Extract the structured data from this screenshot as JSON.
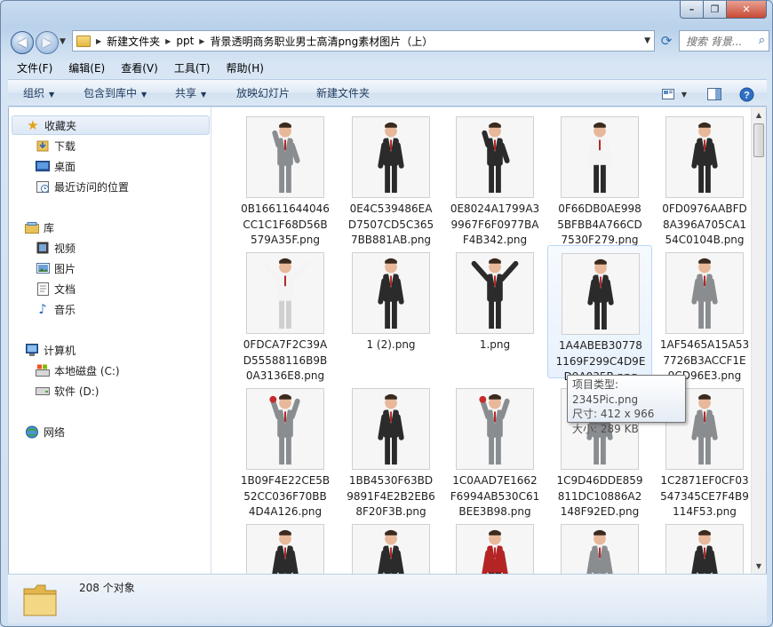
{
  "window": {
    "controls": {
      "min": "–",
      "max": "❐",
      "close": "✕"
    }
  },
  "nav": {
    "back_icon": "back-arrow-icon",
    "forward_icon": "forward-arrow-icon",
    "breadcrumbs": [
      "新建文件夹",
      "ppt",
      "背景透明商务职业男士高清png素材图片（上）"
    ],
    "search_placeholder": "搜索 背景..."
  },
  "menu": [
    "文件(F)",
    "编辑(E)",
    "查看(V)",
    "工具(T)",
    "帮助(H)"
  ],
  "toolbar": {
    "organize": "组织",
    "include_library": "包含到库中",
    "share": "共享",
    "slideshow": "放映幻灯片",
    "new_folder": "新建文件夹"
  },
  "navpane": {
    "favorites": {
      "label": "收藏夹",
      "items": [
        "下载",
        "桌面",
        "最近访问的位置"
      ]
    },
    "libraries": {
      "label": "库",
      "items": [
        "视频",
        "图片",
        "文档",
        "音乐"
      ]
    },
    "computer": {
      "label": "计算机",
      "items": [
        "本地磁盘 (C:)",
        "软件 (D:)"
      ]
    },
    "network": {
      "label": "网络"
    }
  },
  "files": [
    [
      "0B16611644046",
      "CC1C1F68D56B",
      "579A35F.png"
    ],
    [
      "0E4C539486EA",
      "D7507CD5C365",
      "7BB881AB.png"
    ],
    [
      "0E8024A1799A3",
      "9967F6F0977BA",
      "F4B342.png"
    ],
    [
      "0F66DB0AE998",
      "5BFBB4A766CD",
      "7530F279.png"
    ],
    [
      "0FD0976AABFD",
      "8A396A705CA1",
      "54C0104B.png"
    ],
    [
      "0FDCA7F2C39A",
      "D55588116B9B",
      "0A3136E8.png"
    ],
    [
      "1 (2).png"
    ],
    [
      "1.png"
    ],
    [
      "1A4ABEB30778",
      "1169F299C4D9E",
      "D9A035B.png"
    ],
    [
      "1AF5465A15A53",
      "7726B3ACCF1E",
      "9CD96E3.png"
    ],
    [
      "1B09F4E22CE5B",
      "52CC036F70BB",
      "4D4A126.png"
    ],
    [
      "1BB4530F63BD",
      "9891F4E2B2EB6",
      "8F20F3B.png"
    ],
    [
      "1C0AAD7E1662",
      "F6994AB530C61",
      "BEE3B98.png"
    ],
    [
      "1C9D46DDE859",
      "811DC10886A2",
      "148F92ED.png"
    ],
    [
      "1C2871EF0CF03",
      "547345CE7F4B9",
      "114F53.png"
    ],
    [
      ""
    ],
    [
      ""
    ],
    [
      ""
    ],
    [
      ""
    ],
    [
      ""
    ]
  ],
  "tooltip": {
    "type": "项目类型: 2345Pic.png",
    "dimensions": "尺寸: 412 x 966",
    "size": "大小: 289 KB"
  },
  "status": {
    "count": "208 个对象"
  },
  "colors": {
    "suit_dark": "#2b2b2b",
    "shirt_white": "#f4f4f4",
    "tie_red": "#b52424",
    "skin": "#e8b89a",
    "grey_suit": "#8a8d90"
  }
}
